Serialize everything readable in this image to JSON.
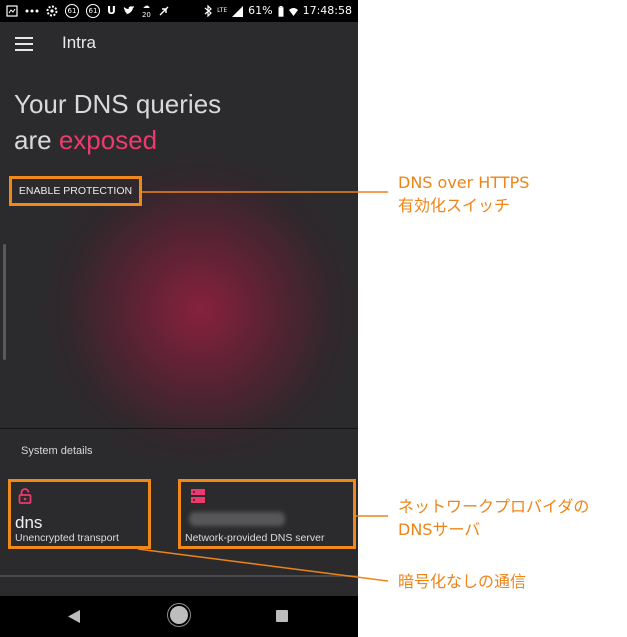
{
  "status_bar": {
    "left_icons": [
      "notification-icon",
      "dots-icon",
      "settings-icon",
      "app-icon",
      "app-icon",
      "uber-icon",
      "twitter-icon",
      "weather-icon",
      "feather-icon"
    ],
    "weather_badge": "20",
    "badge_61": "61",
    "badge_61b": "61",
    "lte": "LTE",
    "battery": "61%",
    "time": "17:48:58"
  },
  "app": {
    "title": "Intra",
    "headline_line1": "Your DNS queries",
    "headline_line2_prefix": "are ",
    "headline_line2_accent": "exposed",
    "enable_button": "ENABLE PROTECTION",
    "section_title": "System details",
    "card_dns": {
      "title": "dns",
      "subtitle": "Unencrypted transport"
    },
    "card_server": {
      "subtitle": "Network-provided DNS server"
    }
  },
  "callouts": {
    "doh_line1": "DNS over HTTPS",
    "doh_line2": "有効化スイッチ",
    "provider_line1": "ネットワークプロバイダの",
    "provider_line2": "DNSサーバ",
    "unencrypted": "暗号化なしの通信"
  },
  "colors": {
    "accent": "#ec3a6c",
    "annotation": "#ee8418",
    "background": "#2b2b2d"
  }
}
